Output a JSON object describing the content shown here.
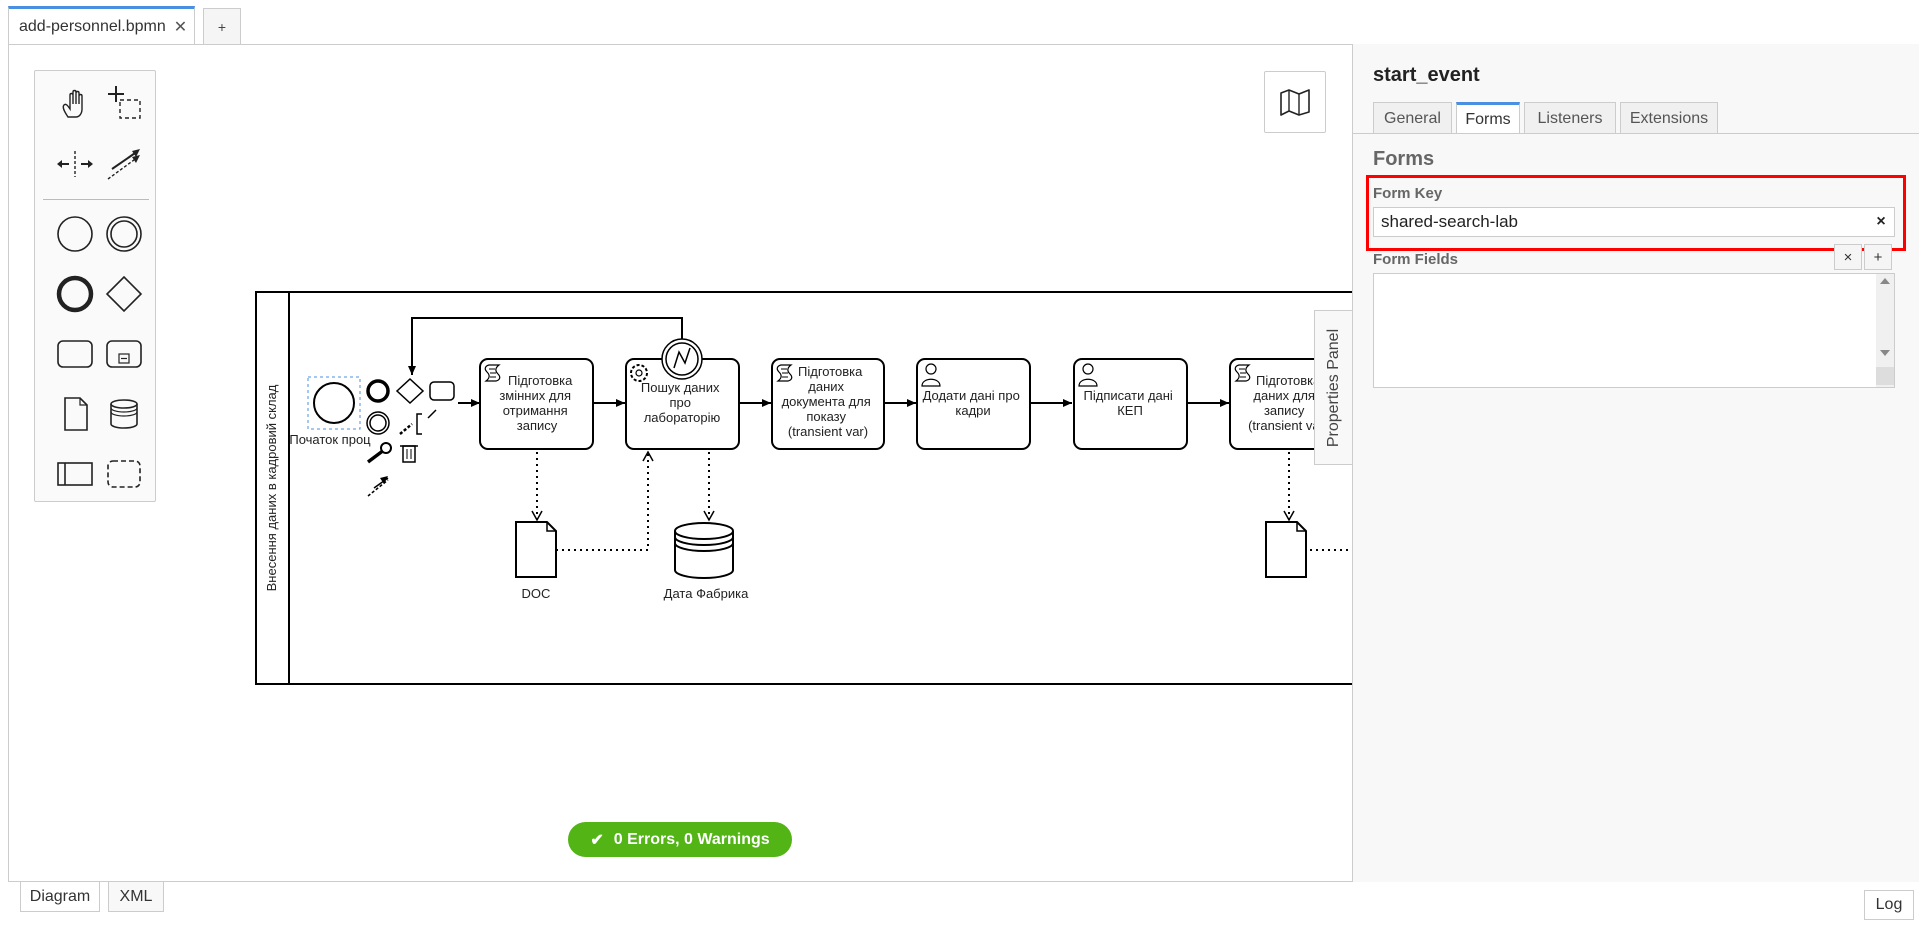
{
  "tabs": {
    "file_tab_label": "add-personnel.bpmn",
    "add_tab_label": "+"
  },
  "diagram": {
    "pool_label": "Внесення даних в кадровий склад",
    "start_event_label": "Початок проц",
    "tasks": [
      {
        "label_lines": [
          "Підготовка",
          "змінних для",
          "отримання",
          "запису"
        ],
        "type": "script"
      },
      {
        "label_lines": [
          "Пошук даних",
          "про",
          "лабораторію"
        ],
        "type": "service"
      },
      {
        "label_lines": [
          "Підготовка",
          "даних",
          "документа для",
          "показу",
          "(transient var)"
        ],
        "type": "script"
      },
      {
        "label_lines": [
          "Додати дані про",
          "кадри"
        ],
        "type": "user"
      },
      {
        "label_lines": [
          "Підписати дані",
          "КЕП"
        ],
        "type": "user"
      },
      {
        "label_lines": [
          "Підготовка",
          "даних для",
          "запису",
          "(transient var"
        ],
        "type": "script"
      }
    ],
    "data_objects": [
      {
        "label": "DOC"
      },
      {
        "label": ""
      }
    ],
    "data_store_label": "Дата Фабрика"
  },
  "status": {
    "text": "0 Errors, 0 Warnings",
    "color": "#52b415"
  },
  "bottom": {
    "diagram_tab": "Diagram",
    "xml_tab": "XML",
    "log_button": "Log"
  },
  "properties_panel": {
    "toggle_label": "Properties Panel",
    "element_id": "start_event",
    "tabs": [
      "General",
      "Forms",
      "Listeners",
      "Extensions"
    ],
    "active_tab": "Forms",
    "section_title": "Forms",
    "form_key_label": "Form Key",
    "form_key_value": "shared-search-lab",
    "form_key_clear": "×",
    "form_fields_label": "Form Fields",
    "form_fields_remove": "×",
    "form_fields_add": "+"
  },
  "colors": {
    "accent": "#4a90e2",
    "highlight": "#ff0000"
  }
}
